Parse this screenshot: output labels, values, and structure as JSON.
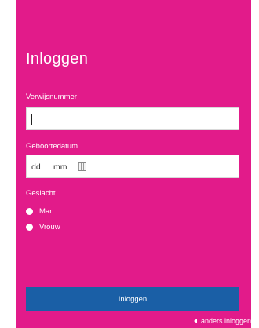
{
  "login": {
    "title": "Inloggen",
    "verwijsnummer_label": "Verwijsnummer",
    "verwijsnummer_value": "",
    "geboortedatum_label": "Geboortedatum",
    "date_day_placeholder": "dd",
    "date_month_placeholder": "mm",
    "geslacht_label": "Geslacht",
    "gender_options": [
      "Man",
      "Vrouw"
    ],
    "submit_label": "Inloggen",
    "other_login_label": "anders inloggen",
    "colors": {
      "panel": "#e21b8a",
      "button": "#1a5fa6"
    },
    "icons": {
      "calendar": "calendar-icon",
      "back": "chevron-left-icon"
    }
  }
}
